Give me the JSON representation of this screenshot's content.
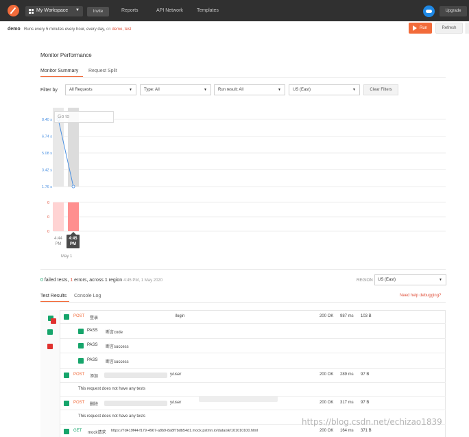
{
  "topbar": {
    "workspace": "My Workspace",
    "invite": "Invite",
    "nav": [
      "Reports",
      "API Network",
      "Templates"
    ],
    "upgrade": "Upgrade"
  },
  "header": {
    "name": "demo",
    "schedule": "Runs every 5 minutes every hour, every day,",
    "on_word": "on",
    "collection": "demo,",
    "env": "test",
    "run": "Run",
    "refresh": "Refresh"
  },
  "perf": {
    "title": "Monitor Performance",
    "tabs": [
      "Monitor Summary",
      "Request Split"
    ],
    "filter_label": "Filter by",
    "filters": [
      "All Requests",
      "Type: All",
      "Run result: All",
      "US (East)"
    ],
    "clear": "Clear Filters",
    "goto_placeholder": "Go to"
  },
  "chart_data": {
    "type": "line",
    "x": [
      "4:44 PM",
      "4:45 PM"
    ],
    "date": "May 1",
    "y_ticks_top": [
      "8.40 s",
      "6.74 s",
      "5.08 s",
      "3.42 s",
      "1.76 s"
    ],
    "y_ticks_bottom": [
      "0",
      "0",
      "0"
    ],
    "series": [
      {
        "values": [
          8.4,
          1.76
        ]
      }
    ],
    "colors": {
      "line": "#4a90e2",
      "failure_bar": "#ff8f8f",
      "failure_bar_light": "#ffd3d3",
      "run_band": "#e8e8e8"
    }
  },
  "summary": {
    "failed_count": "0",
    "failed_text": "failed tests,",
    "errors_count": "1",
    "errors_text": "errors, across 1 region",
    "timestamp": "4:45 PM, 1 May 2020",
    "region_label": "REGION",
    "region": "US (East)"
  },
  "results": {
    "tabs": [
      "Test Results",
      "Console Log"
    ],
    "help": "Need help debugging?",
    "rows": [
      {
        "method": "POST",
        "name": "登录",
        "path": "/login",
        "status": "200 OK",
        "time": "987 ms",
        "size": "103 B"
      },
      {
        "pass": "PASS",
        "assert": "断言code"
      },
      {
        "pass": "PASS",
        "assert": "断言success"
      },
      {
        "pass": "PASS",
        "assert": "断言success"
      },
      {
        "method": "POST",
        "name": "添加",
        "path": "y/user",
        "status": "200 OK",
        "time": "289 ms",
        "size": "97 B"
      },
      {
        "note": "This request does not have any tests"
      },
      {
        "method": "POST",
        "name": "删除",
        "path": "y/user",
        "status": "200 OK",
        "time": "317 ms",
        "size": "97 B"
      },
      {
        "note": "This request does not have any tests"
      },
      {
        "method": "GET",
        "name": "mock请求",
        "url": "https://7d419f44-f179-4967-a8b9-8a8f7bdb54d1.mock.pstmn.io/data/sk/101010100.html",
        "status": "200 OK",
        "time": "164 ms",
        "size": "371 B"
      }
    ]
  },
  "watermark": "https://blog.csdn.net/echizao1839"
}
